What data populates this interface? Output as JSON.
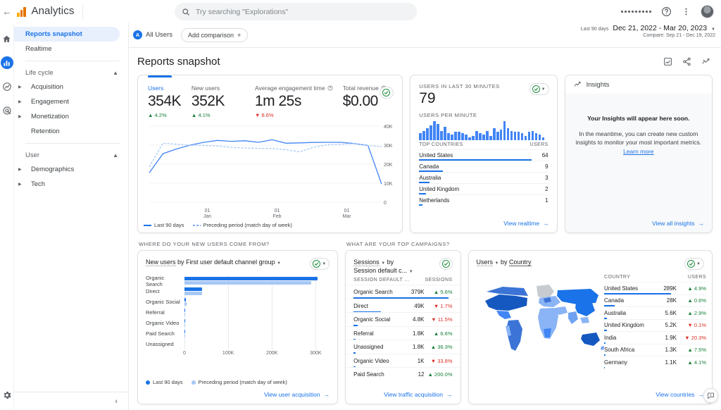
{
  "topbar": {
    "back_icon": "back-arrow-icon",
    "brand": "Analytics",
    "search_placeholder": "Try searching \"Explorations\"",
    "apps_icon": "apps-grid-icon",
    "help_icon": "help-circle-icon",
    "more_icon": "more-vertical-icon",
    "avatar": "user-avatar"
  },
  "rail": {
    "items": [
      {
        "icon": "home-icon",
        "active": false
      },
      {
        "icon": "reports-bar-chart-icon",
        "active": true
      },
      {
        "icon": "explore-compass-icon",
        "active": false
      },
      {
        "icon": "advertising-target-icon",
        "active": false
      }
    ],
    "gear_icon": "settings-gear-icon"
  },
  "sidebar": {
    "items": [
      {
        "label": "Reports snapshot",
        "selected": true
      },
      {
        "label": "Realtime",
        "selected": false
      }
    ],
    "groups": [
      {
        "label": "Life cycle",
        "items": [
          {
            "label": "Acquisition",
            "expandable": true
          },
          {
            "label": "Engagement",
            "expandable": true
          },
          {
            "label": "Monetization",
            "expandable": true
          },
          {
            "label": "Retention",
            "expandable": false
          }
        ]
      },
      {
        "label": "User",
        "items": [
          {
            "label": "Demographics",
            "expandable": true
          },
          {
            "label": "Tech",
            "expandable": true
          }
        ]
      }
    ],
    "collapse_icon": "chevron-left-icon"
  },
  "controls": {
    "segment_initial": "A",
    "segment_label": "All Users",
    "add_comparison": "Add comparison",
    "date_prefix": "Last 90 days",
    "date_range": "Dec 21, 2022 - Mar 20, 2023",
    "compare_text": "Compare: Sep 21 - Dec 19, 2022"
  },
  "page": {
    "title": "Reports snapshot",
    "actions": [
      "customize-report-icon",
      "share-icon",
      "insights-icon"
    ]
  },
  "metrics_card": {
    "metrics": [
      {
        "label": "Users",
        "value": "354K",
        "delta": "4.2%",
        "dir": "up",
        "active": true,
        "help": false
      },
      {
        "label": "New users",
        "value": "352K",
        "delta": "4.1%",
        "dir": "up",
        "active": false,
        "help": false
      },
      {
        "label": "Average engagement time",
        "value": "1m 25s",
        "delta": "8.6%",
        "dir": "down",
        "active": false,
        "help": true
      },
      {
        "label": "Total revenue",
        "value": "$0.00",
        "delta": "",
        "dir": "",
        "active": false,
        "help": true
      }
    ],
    "legend": [
      {
        "label": "Last 90 days",
        "style": "solid"
      },
      {
        "label": "Preceding period (match day of week)",
        "style": "dashed"
      }
    ]
  },
  "realtime_card": {
    "caption": "USERS IN LAST 30 MINUTES",
    "value": "79",
    "per_minute_caption": "USERS PER MINUTE",
    "table_header": {
      "left": "TOP COUNTRIES",
      "right": "USERS"
    },
    "rows": [
      {
        "country": "United States",
        "users": "64",
        "pct": 100
      },
      {
        "country": "Canada",
        "users": "9",
        "pct": 21
      },
      {
        "country": "Australia",
        "users": "3",
        "pct": 9
      },
      {
        "country": "United Kingdom",
        "users": "2",
        "pct": 6
      },
      {
        "country": "Netherlands",
        "users": "1",
        "pct": 3
      }
    ],
    "link": "View realtime"
  },
  "insights_card": {
    "title": "Insights",
    "icon": "insights-sparkline-icon",
    "headline": "Your Insights will appear here soon.",
    "body": "In the meantime, you can create new custom insights to monitor your most important metrics.",
    "link_inline": "Learn more",
    "link": "View all insights"
  },
  "sections": {
    "acquisition": "WHERE DO YOUR NEW USERS COME FROM?",
    "campaigns": "WHAT ARE YOUR TOP CAMPAIGNS?"
  },
  "acquisition_card": {
    "title_prefix": "New users",
    "title_mid": "by",
    "title_dim": "First user default channel group",
    "link": "View user acquisition",
    "legend": [
      {
        "label": "Last 90 days"
      },
      {
        "label": "Preceding period (match day of week)"
      }
    ]
  },
  "campaigns_card": {
    "title_metric": "Sessions",
    "title_by": "by",
    "title_dim": "Session default c...",
    "header": {
      "left": "SESSION DEFAULT ...",
      "right": "SESSIONS"
    },
    "link": "View traffic acquisition"
  },
  "map_card": {
    "title_metric": "Users",
    "title_by": "by",
    "title_dim": "Country",
    "header": {
      "left": "COUNTRY",
      "right": "USERS"
    },
    "link": "View countries"
  },
  "feedback_icon": "feedback-icon",
  "colors": {
    "accent": "#1a73e8",
    "accent_light": "#a6c8f5",
    "up": "#188038",
    "down": "#d93025",
    "check": "#1e8e3e"
  },
  "chart_data": [
    {
      "type": "line",
      "title": "Users over time",
      "xlabel": "",
      "ylabel": "Users",
      "ylim": [
        0,
        40000
      ],
      "yticks": [
        "0",
        "10K",
        "20K",
        "30K",
        "40K"
      ],
      "xticks": [
        {
          "top": "01",
          "bottom": "Jan"
        },
        {
          "top": "01",
          "bottom": "Feb"
        },
        {
          "top": "01",
          "bottom": "Mar"
        }
      ],
      "grid": true,
      "legend_position": "bottom-left",
      "series": [
        {
          "name": "Last 90 days",
          "style": "solid",
          "color": "#4285f4",
          "values": [
            15500,
            25500,
            28000,
            30000,
            31500,
            32500,
            32000,
            32300,
            31500,
            32800,
            31000,
            31200,
            31400,
            31500,
            31500,
            30800,
            29800,
            9500
          ]
        },
        {
          "name": "Preceding period (match day of week)",
          "style": "dashed",
          "color": "#a6c8f5",
          "values": [
            18500,
            31000,
            30500,
            30000,
            29800,
            29500,
            28800,
            28500,
            28300,
            28200,
            27600,
            26500,
            28800,
            30200,
            30500,
            30800,
            29800,
            29200
          ]
        }
      ]
    },
    {
      "type": "bar",
      "title": "Users per minute",
      "orientation": "vertical",
      "color": "#4285f4",
      "values": [
        5,
        7,
        9,
        11,
        14,
        12,
        7,
        10,
        5,
        4,
        6,
        6,
        5,
        4,
        2,
        3,
        7,
        5,
        4,
        7,
        3,
        9,
        6,
        8,
        14,
        9,
        7,
        6,
        6,
        5,
        3,
        6,
        7,
        5,
        4,
        2
      ],
      "ylim": [
        0,
        14
      ]
    },
    {
      "type": "bar",
      "title": "New users by First user default channel group",
      "orientation": "horizontal",
      "categories": [
        "Organic Search",
        "Direct",
        "Organic Social",
        "Referral",
        "Organic Video",
        "Paid Search",
        "Unassigned"
      ],
      "xticks": [
        "0",
        "100K",
        "200K",
        "300K"
      ],
      "xlim": [
        0,
        330000
      ],
      "series": [
        {
          "name": "Last 90 days",
          "color": "#1a73e8",
          "values": [
            305000,
            41000,
            4000,
            1800,
            1500,
            300,
            0
          ]
        },
        {
          "name": "Preceding period (match day of week)",
          "color": "#a6c8f5",
          "values": [
            290000,
            40000,
            4500,
            1500,
            1200,
            200,
            0
          ]
        }
      ]
    },
    {
      "type": "table",
      "title": "Sessions by Session default channel group",
      "columns": [
        "SESSION DEFAULT ...",
        "SESSIONS",
        "change"
      ],
      "rows": [
        {
          "name": "Organic Search",
          "value": "379K",
          "delta": "5.6%",
          "dir": "up",
          "pct": 100
        },
        {
          "name": "Direct",
          "value": "49K",
          "delta": "1.7%",
          "dir": "down",
          "pct": 29
        },
        {
          "name": "Organic Social",
          "value": "4.8K",
          "delta": "11.5%",
          "dir": "down",
          "pct": 4
        },
        {
          "name": "Referral",
          "value": "1.8K",
          "delta": "6.6%",
          "dir": "up",
          "pct": 2
        },
        {
          "name": "Unassigned",
          "value": "1.8K",
          "delta": "36.3%",
          "dir": "up",
          "pct": 2
        },
        {
          "name": "Organic Video",
          "value": "1K",
          "delta": "33.8%",
          "dir": "down",
          "pct": 2
        },
        {
          "name": "Paid Search",
          "value": "12",
          "delta": "200.0%",
          "dir": "up",
          "pct": 0
        }
      ]
    },
    {
      "type": "heatmap",
      "title": "Users by Country",
      "map": "world-choropleth",
      "rows": [
        {
          "name": "United States",
          "value": "289K",
          "delta": "4.9%",
          "dir": "up",
          "pct": 100
        },
        {
          "name": "Canada",
          "value": "28K",
          "delta": "0.6%",
          "dir": "up",
          "pct": 16
        },
        {
          "name": "Australia",
          "value": "5.6K",
          "delta": "2.9%",
          "dir": "up",
          "pct": 4
        },
        {
          "name": "United Kingdom",
          "value": "5.2K",
          "delta": "0.1%",
          "dir": "down",
          "pct": 4
        },
        {
          "name": "India",
          "value": "1.9K",
          "delta": "20.3%",
          "dir": "down",
          "pct": 2
        },
        {
          "name": "South Africa",
          "value": "1.3K",
          "delta": "7.5%",
          "dir": "up",
          "pct": 2
        },
        {
          "name": "Germany",
          "value": "1.1K",
          "delta": "4.1%",
          "dir": "up",
          "pct": 1
        }
      ]
    }
  ]
}
